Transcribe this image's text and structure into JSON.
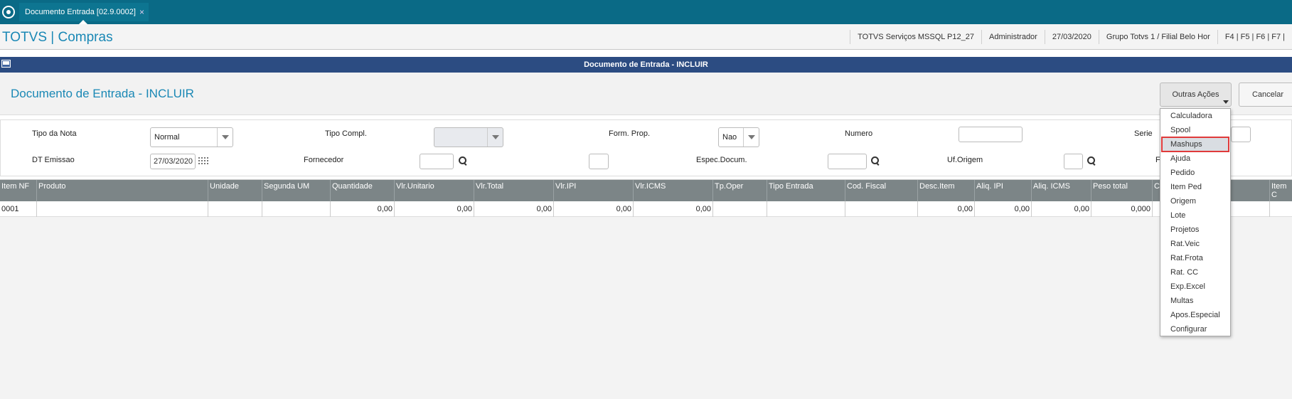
{
  "tab": {
    "label": "Documento Entrada [02.9.0002]",
    "close": "×"
  },
  "app": {
    "name": "TOTVS | Compras"
  },
  "header_info": [
    "TOTVS Serviços MSSQL P12_27",
    "Administrador",
    "27/03/2020",
    "Grupo Totvs 1 / Filial Belo Hor",
    "F4 | F5 | F6 | F7 |"
  ],
  "window": {
    "title": "Documento de Entrada - INCLUIR"
  },
  "page": {
    "title": "Documento de Entrada - INCLUIR"
  },
  "actions": {
    "outras": "Outras Ações",
    "cancelar": "Cancelar"
  },
  "form": {
    "tipo_nota_label": "Tipo da Nota",
    "tipo_nota_value": "Normal",
    "tipo_compl_label": "Tipo Compl.",
    "form_prop_label": "Form. Prop.",
    "form_prop_value": "Nao",
    "numero_label": "Numero",
    "serie_label": "Serie",
    "dt_emissao_label": "DT Emissao",
    "dt_emissao_value": "27/03/2020",
    "fornecedor_label": "Fornecedor",
    "espec_label": "Espec.Docum.",
    "uf_label": "Uf.Origem",
    "extra_label": "F"
  },
  "grid": {
    "headers": [
      "Item NF",
      "Produto",
      "Unidade",
      "Segunda UM",
      "Quantidade",
      "Vlr.Unitario",
      "Vlr.Total",
      "Vlr.IPI",
      "Vlr.ICMS",
      "Tp.Oper",
      "Tipo Entrada",
      "Cod. Fiscal",
      "Desc.Item",
      "Aliq. IPI",
      "Aliq. ICMS",
      "Peso total",
      "C",
      "Item C"
    ],
    "row": [
      "0001",
      "",
      "",
      "",
      "0,00",
      "0,00",
      "0,00",
      "0,00",
      "0,00",
      "",
      "",
      "",
      "0,00",
      "0,00",
      "0,00",
      "0,000",
      "",
      ""
    ]
  },
  "menu": {
    "items": [
      "Calculadora",
      "Spool",
      "Mashups",
      "Ajuda",
      "Pedido",
      "Item Ped",
      "Origem",
      "Lote",
      "Projetos",
      "Rat.Veic",
      "Rat.Frota",
      "Rat. CC",
      "Exp.Excel",
      "Multas",
      "Apos.Especial",
      "Configurar"
    ],
    "highlighted": "Mashups",
    "highlight_color": "#e03a3a"
  }
}
